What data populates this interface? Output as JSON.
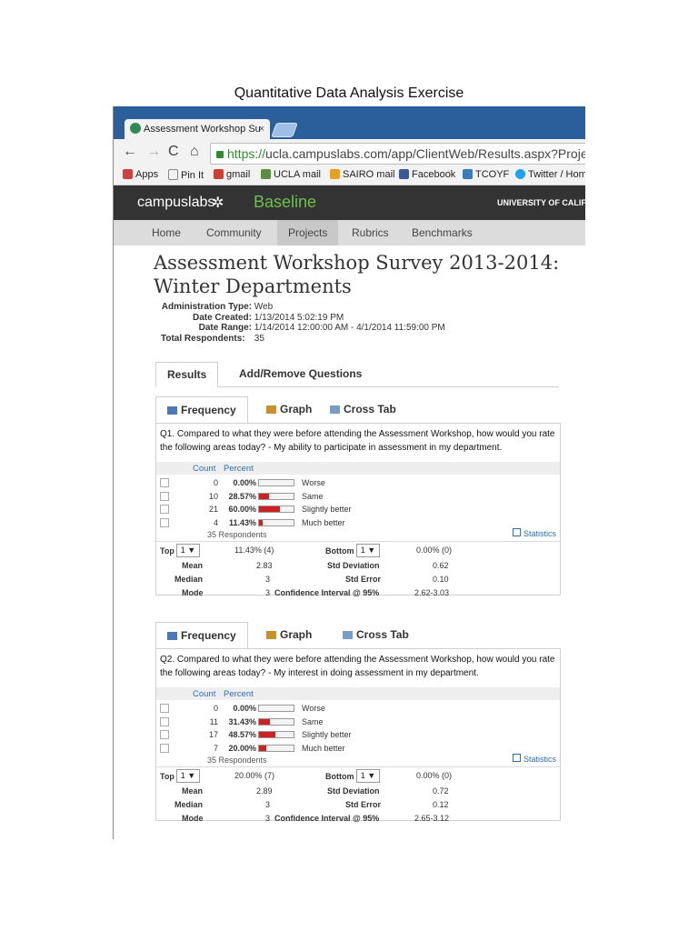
{
  "doc_title": "Quantitative Data Analysis Exercise",
  "browser": {
    "tab_title": "Assessment Workshop Su",
    "tab_close": "×",
    "url_protocol": "https://",
    "url_rest": "ucla.campuslabs.com/app/ClientWeb/Results.aspx?ProjectId=",
    "bookmarks": [
      "Apps",
      "Pin It",
      "gmail",
      "UCLA mail",
      "SAIRO mail",
      "Facebook",
      "TCOYF",
      "Twitter / Hom"
    ]
  },
  "header": {
    "logo": "campuslabs",
    "product": "Baseline",
    "university": "UNIVERSITY OF CALIFO"
  },
  "nav": [
    "Home",
    "Community",
    "Projects",
    "Rubrics",
    "Benchmarks"
  ],
  "survey": {
    "title_line1": "Assessment Workshop Survey 2013-2014:",
    "title_line2": "Winter Departments",
    "meta": [
      {
        "label": "Administration Type:",
        "value": "Web"
      },
      {
        "label": "Date Created:",
        "value": "1/13/2014 5:02:19 PM"
      },
      {
        "label": "Date Range:",
        "value": "1/14/2014 12:00:00 AM - 4/1/2014 11:59:00 PM"
      },
      {
        "label": "Total Respondents:",
        "value": "35"
      }
    ]
  },
  "result_tabs": [
    "Results",
    "Add/Remove Questions"
  ],
  "panel_tabs": [
    "Frequency",
    "Graph",
    "Cross Tab"
  ],
  "col_headers": {
    "count": "Count",
    "percent": "Percent"
  },
  "stats_labels": {
    "top": "Top",
    "bottom": "Bottom",
    "mean": "Mean",
    "median": "Median",
    "mode": "Mode",
    "std_dev": "Std Deviation",
    "std_err": "Std Error",
    "ci": "Confidence Interval @ 95%",
    "statistics": "Statistics",
    "select_value": "1 ▼"
  },
  "questions": [
    {
      "text": "Q1. Compared to what they were before attending the Assessment Workshop, how would you rate the following areas today? - My ability to participate in assessment in my department.",
      "rows": [
        {
          "count": "0",
          "percent": "0.00%",
          "fraction": 0.0,
          "label": "Worse"
        },
        {
          "count": "10",
          "percent": "28.57%",
          "fraction": 0.2857,
          "label": "Same"
        },
        {
          "count": "21",
          "percent": "60.00%",
          "fraction": 0.6,
          "label": "Slightly better"
        },
        {
          "count": "4",
          "percent": "11.43%",
          "fraction": 0.1143,
          "label": "Much better"
        }
      ],
      "respondents": "35 Respondents",
      "top_value": "11.43% (4)",
      "bottom_value": "0.00% (0)",
      "mean": "2.83",
      "median": "3",
      "mode": "3",
      "std_dev": "0.62",
      "std_err": "0.10",
      "ci": "2.62-3.03"
    },
    {
      "text": "Q2. Compared to what they were before attending the Assessment Workshop, how would you rate the following areas today? - My interest in doing assessment in my department.",
      "rows": [
        {
          "count": "0",
          "percent": "0.00%",
          "fraction": 0.0,
          "label": "Worse"
        },
        {
          "count": "11",
          "percent": "31.43%",
          "fraction": 0.3143,
          "label": "Same"
        },
        {
          "count": "17",
          "percent": "48.57%",
          "fraction": 0.4857,
          "label": "Slightly better"
        },
        {
          "count": "7",
          "percent": "20.00%",
          "fraction": 0.2,
          "label": "Much better"
        }
      ],
      "respondents": "35 Respondents",
      "top_value": "20.00% (7)",
      "bottom_value": "0.00% (0)",
      "mean": "2.89",
      "median": "3",
      "mode": "3",
      "std_dev": "0.72",
      "std_err": "0.12",
      "ci": "2.65-3.12"
    }
  ]
}
